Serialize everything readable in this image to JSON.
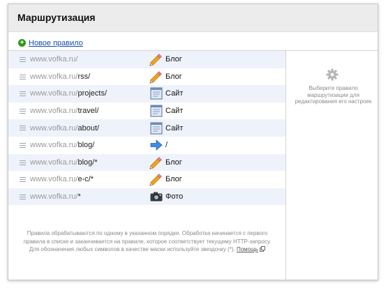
{
  "header": {
    "title": "Маршрутизация"
  },
  "toolbar": {
    "new_rule_label": "Новое правило"
  },
  "rules": [
    {
      "domain": "www.vofka.ru/",
      "path": "",
      "icon": "pencil-icon",
      "target": "Блог"
    },
    {
      "domain": "www.vofka.ru/",
      "path": "rss/",
      "icon": "pencil-icon",
      "target": "Блог"
    },
    {
      "domain": "www.vofka.ru/",
      "path": "projects/",
      "icon": "window-icon",
      "target": "Сайт"
    },
    {
      "domain": "www.vofka.ru/",
      "path": "travel/",
      "icon": "window-icon",
      "target": "Сайт"
    },
    {
      "domain": "www.vofka.ru/",
      "path": "about/",
      "icon": "window-icon",
      "target": "Сайт"
    },
    {
      "domain": "www.vofka.ru/",
      "path": "blog/",
      "icon": "arrow-right-icon",
      "target": "/"
    },
    {
      "domain": "www.vofka.ru/",
      "path": "blog/*",
      "icon": "pencil-icon",
      "target": "Блог"
    },
    {
      "domain": "www.vofka.ru/",
      "path": "e-c/*",
      "icon": "pencil-icon",
      "target": "Блог"
    },
    {
      "domain": "www.vofka.ru/",
      "path": "*",
      "icon": "camera-icon",
      "target": "Фото"
    }
  ],
  "sidebar": {
    "hint": "Выберите правило маршрутизации для редактирования его настроек"
  },
  "footer": {
    "line1": "Правила обрабатываются по одному в указанном порядке. Обработка начинается с первого",
    "line2": "правила в списке и заканчивается на правиле, которое соответствует текущему HTTP-запросу.",
    "line3": "Для обозначения любых символов в качестве маски используйте звездочку (*).",
    "help_label": "Помощь"
  },
  "colors": {
    "row_alt": "#eef2fb",
    "link": "#1a4aa8",
    "add": "#2f9a1c"
  }
}
